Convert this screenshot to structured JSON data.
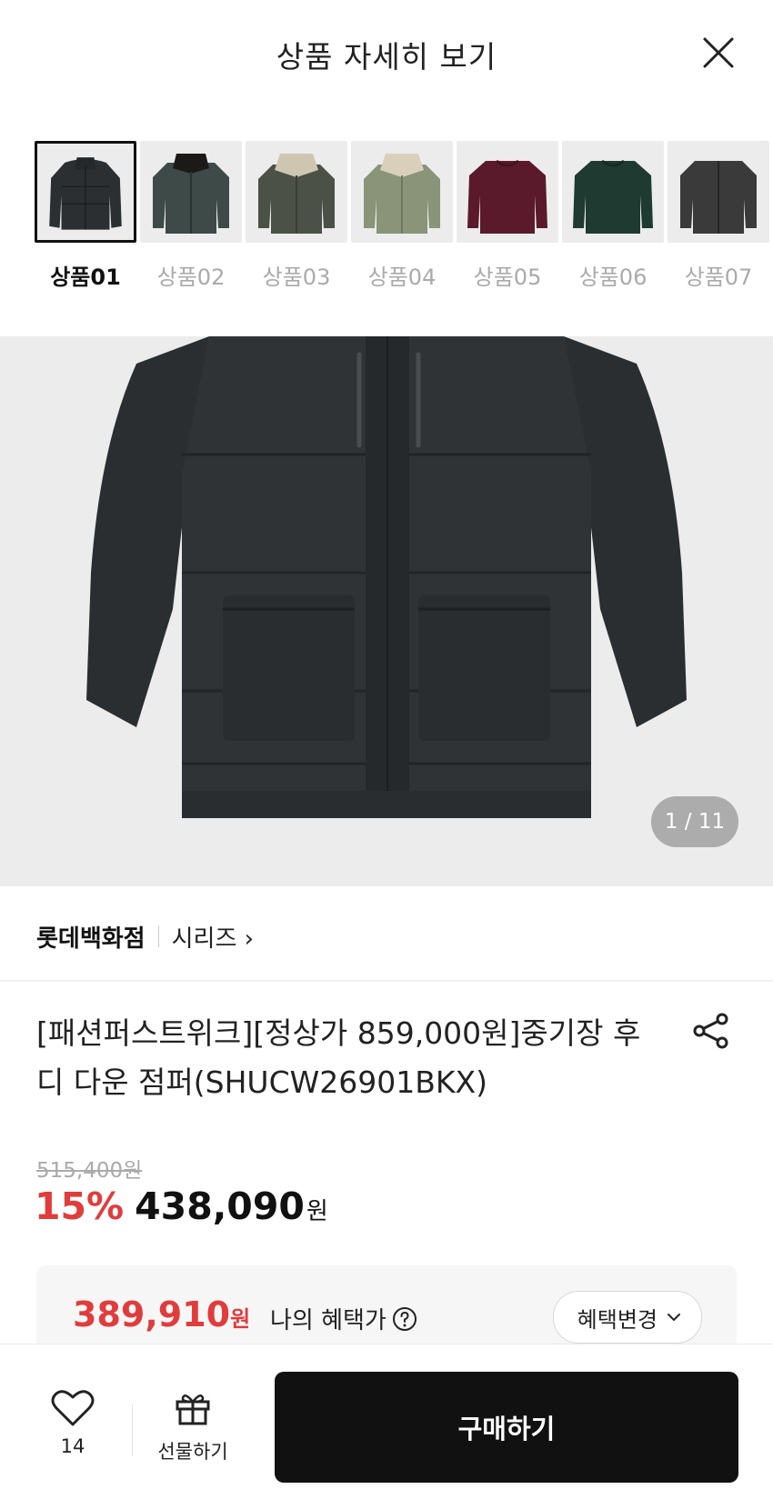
{
  "header": {
    "title": "상품 자세히 보기"
  },
  "thumbnails": [
    {
      "label": "상품01",
      "active": true
    },
    {
      "label": "상품02",
      "active": false
    },
    {
      "label": "상품03",
      "active": false
    },
    {
      "label": "상품04",
      "active": false
    },
    {
      "label": "상품05",
      "active": false
    },
    {
      "label": "상품06",
      "active": false
    },
    {
      "label": "상품07",
      "active": false
    }
  ],
  "hero": {
    "counter": "1 / 11"
  },
  "brand": {
    "name": "롯데백화점",
    "series": "시리즈 ›"
  },
  "product": {
    "name": "[패션퍼스트위크][정상가 859,000원]중기장 후디 다운 점퍼(SHUCW26901BKX)",
    "original_price": "515,400원",
    "discount": "15%",
    "price": "438,090",
    "price_unit": "원"
  },
  "benefit": {
    "price": "389,910",
    "unit": "원",
    "label": "나의 혜택가",
    "change_button": "혜택변경"
  },
  "bottom": {
    "like_count": "14",
    "gift_label": "선물하기",
    "buy_label": "구매하기"
  }
}
